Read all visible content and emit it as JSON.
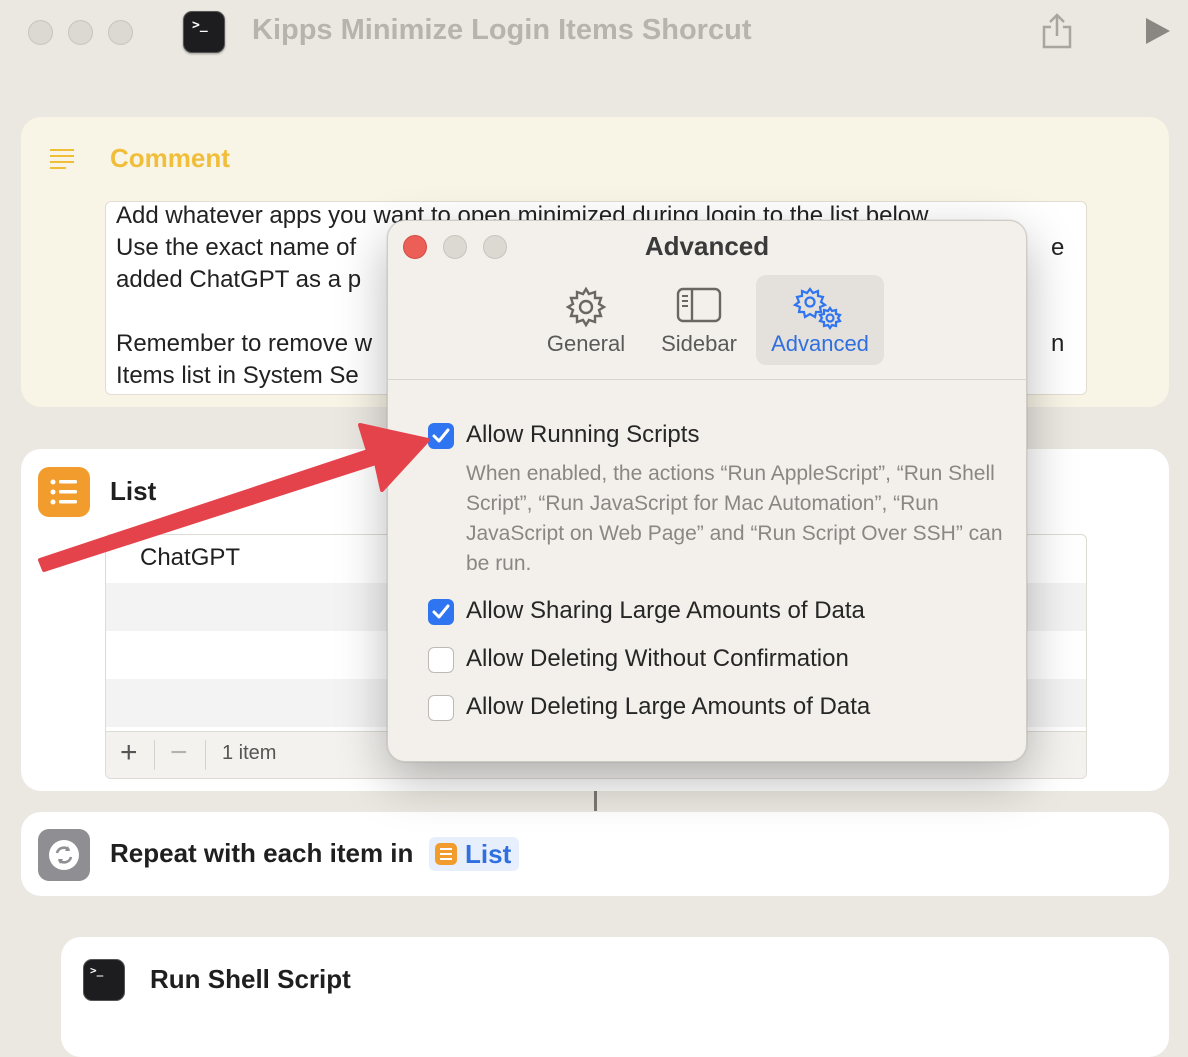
{
  "window": {
    "title": "Kipps Minimize Login Items Shorcut",
    "app_icon_glyph": ">_"
  },
  "comment": {
    "title": "Comment",
    "lines": [
      "Add whatever apps you want to open minimized during login to the list below.",
      "Use the exact name of",
      "added ChatGPT as a p",
      "",
      "Remember to remove w",
      "Items list in System Se"
    ],
    "right_fragments": [
      "e",
      "n"
    ]
  },
  "list": {
    "title": "List",
    "items": [
      "ChatGPT"
    ],
    "add_label": "+",
    "remove_label": "−",
    "count_label": "1 item"
  },
  "repeat": {
    "text": "Repeat with each item in",
    "token": "List"
  },
  "shell": {
    "title": "Run Shell Script",
    "icon_glyph": ">_"
  },
  "dialog": {
    "title": "Advanced",
    "tabs": [
      {
        "label": "General",
        "icon": "gear-icon"
      },
      {
        "label": "Sidebar",
        "icon": "sidebar-icon"
      },
      {
        "label": "Advanced",
        "icon": "gears-icon",
        "active": true
      }
    ],
    "options": [
      {
        "label": "Allow Running Scripts",
        "checked": true
      },
      {
        "label": "Allow Sharing Large Amounts of Data",
        "checked": true
      },
      {
        "label": "Allow Deleting Without Confirmation",
        "checked": false
      },
      {
        "label": "Allow Deleting Large Amounts of Data",
        "checked": false
      }
    ],
    "running_scripts_description": "When enabled, the actions “Run AppleScript”, “Run Shell Script”, “Run JavaScript for Mac Automation”, “Run JavaScript on Web Page” and “Run Script Over SSH” can be run."
  },
  "colors": {
    "accent": "#2f74f0",
    "comment_title": "#f1be3a",
    "list_icon": "#f39c2e",
    "annotation_arrow": "#e5434b",
    "close_button": "#ec5f57"
  }
}
